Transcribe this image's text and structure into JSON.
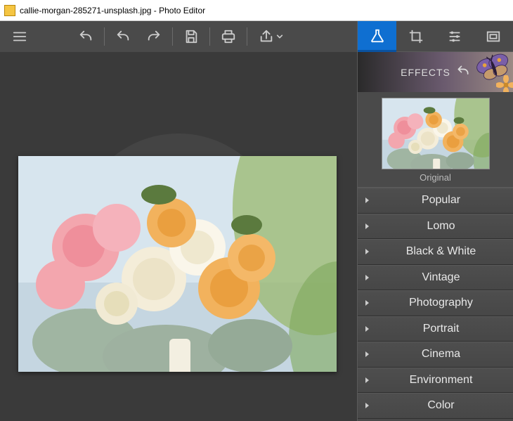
{
  "window": {
    "title": "callie-morgan-285271-unsplash.jpg - Photo Editor"
  },
  "toolbar": {
    "icons": {
      "menu": "menu-icon",
      "undo_big": "undo-icon",
      "undo": "undo-icon",
      "redo": "redo-icon",
      "save": "save-icon",
      "print": "print-icon",
      "share": "share-icon",
      "share_chevron": "chevron-down-icon"
    }
  },
  "right_panel": {
    "tabs": [
      {
        "name": "effects-tab",
        "icon": "flask-icon",
        "active": true
      },
      {
        "name": "crop-tab",
        "icon": "crop-icon",
        "active": false
      },
      {
        "name": "adjust-tab",
        "icon": "sliders-icon",
        "active": false
      },
      {
        "name": "frames-tab",
        "icon": "frame-icon",
        "active": false
      }
    ],
    "header": {
      "label": "EFFECTS",
      "undo_icon": "undo-icon"
    },
    "thumbnail": {
      "label": "Original"
    },
    "categories": [
      {
        "label": "Popular"
      },
      {
        "label": "Lomo"
      },
      {
        "label": "Black & White"
      },
      {
        "label": "Vintage"
      },
      {
        "label": "Photography"
      },
      {
        "label": "Portrait"
      },
      {
        "label": "Cinema"
      },
      {
        "label": "Environment"
      },
      {
        "label": "Color"
      }
    ]
  },
  "canvas": {
    "image_name": "callie-morgan-285271-unsplash.jpg"
  },
  "colors": {
    "accent": "#0f6fd1",
    "bg": "#3a3a3a",
    "panel": "#4a4a4a"
  }
}
